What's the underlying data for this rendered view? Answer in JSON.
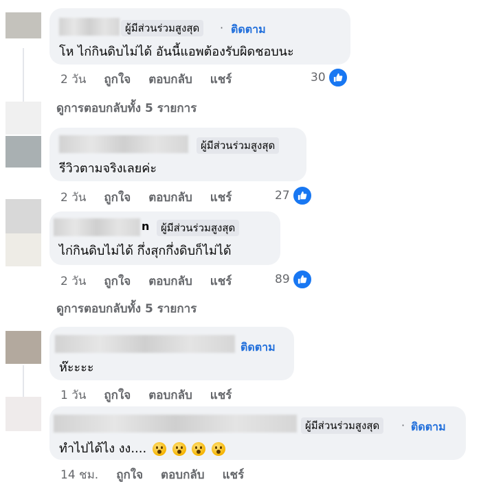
{
  "labels": {
    "top_fan": "ผู้มีส่วนร่วมสูงสุด",
    "follow": "ติดตาม",
    "like": "ถูกใจ",
    "reply": "ตอบกลับ",
    "share": "แชร์",
    "separator": "·",
    "view_replies": "ดูการตอบกลับทั้ง 5 รายการ"
  },
  "comments": [
    {
      "text": "โห ไก่กินดิบไม่ได้ อันนี้แอพต้องรับผิดชอบนะ",
      "time": "2 วัน",
      "reactions": "30"
    },
    {
      "text": "รีวิวตามจริงเลยค่ะ",
      "time": "2 วัน",
      "reactions": "27"
    },
    {
      "name_suffix": "n",
      "text": "ไก่กินดิบไม่ได้ กึ่งสุกกึ่งดิบก็ไม่ได้",
      "time": "2 วัน",
      "reactions": "89"
    },
    {
      "text": "ห๊ะะะะ",
      "time": "1 วัน"
    },
    {
      "text": "ทำไปได้ไง งง....",
      "time": "14 ชม."
    }
  ]
}
